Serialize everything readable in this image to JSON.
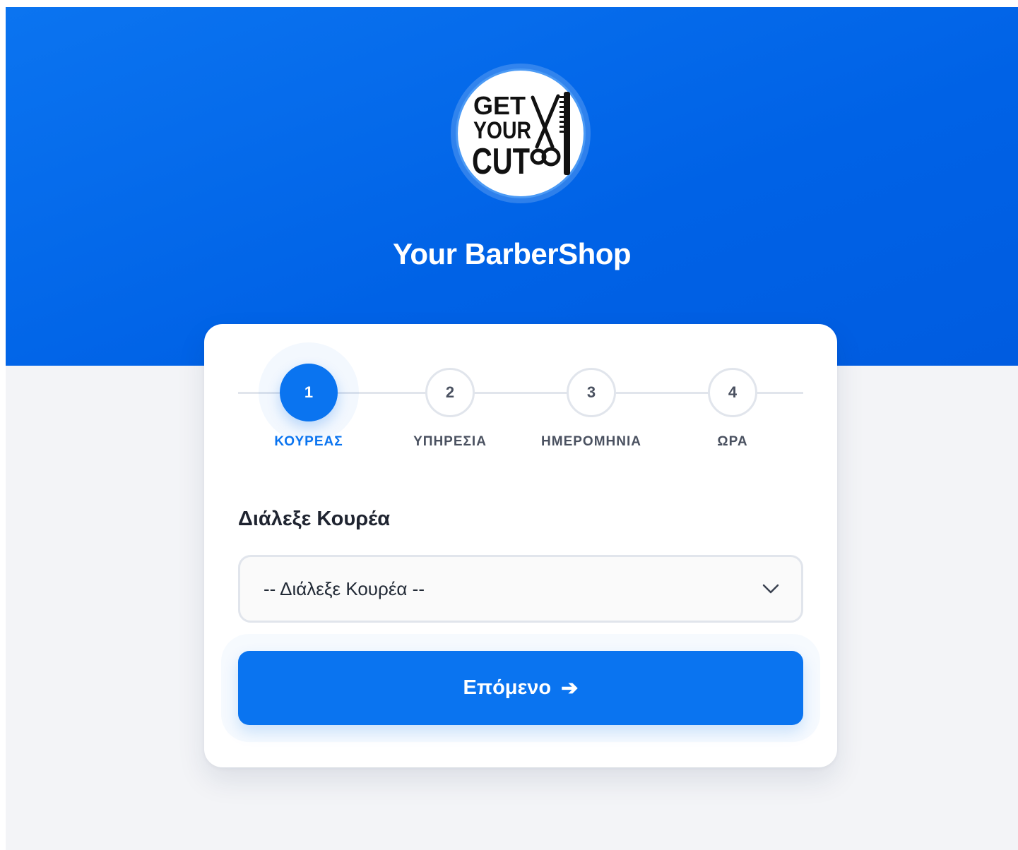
{
  "header": {
    "logo": {
      "icon": "barbershop-logo-icon",
      "text_lines": [
        "GET",
        "YOUR",
        "CUT"
      ]
    },
    "shop_name": "Your BarberShop"
  },
  "stepper": {
    "active_index": 0,
    "steps": [
      {
        "number": "1",
        "label": "ΚΟΥΡΕΑΣ"
      },
      {
        "number": "2",
        "label": "ΥΠΗΡΕΣΙΑ"
      },
      {
        "number": "3",
        "label": "ΗΜΕΡΟΜΗΝΙΑ"
      },
      {
        "number": "4",
        "label": "ΩΡΑ"
      }
    ]
  },
  "form": {
    "title": "Διάλεξε Κουρέα",
    "barber_select": {
      "value": "-- Διάλεξε Κουρέα --",
      "icon": "chevron-down-icon"
    }
  },
  "actions": {
    "next_label": "Επόμενο",
    "next_icon": "➔"
  },
  "colors": {
    "primary": "#0a74f0",
    "hero_bg": "#0062e6",
    "page_bg": "#f3f4f7",
    "step_inactive": "#4a5160"
  }
}
